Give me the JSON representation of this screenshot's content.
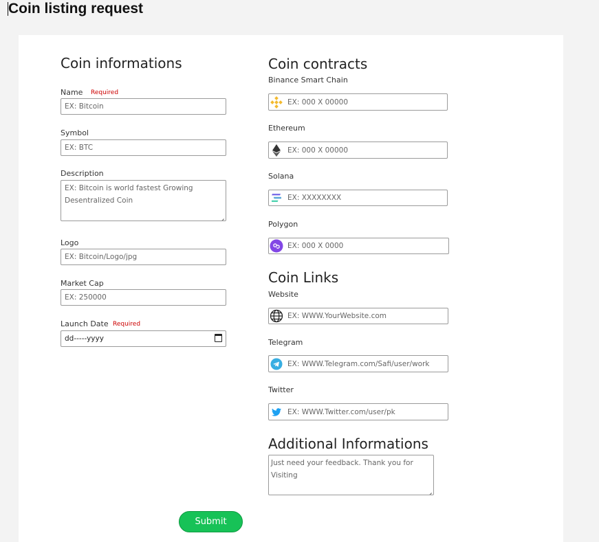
{
  "page": {
    "title": "Coin listing request"
  },
  "coin_info": {
    "heading": "Coin informations",
    "required_text": "Required",
    "name": {
      "label": "Name",
      "placeholder": "EX: Bitcoin"
    },
    "symbol": {
      "label": "Symbol",
      "placeholder": "EX: BTC"
    },
    "description": {
      "label": "Description",
      "placeholder": "EX: Bitcoin is world fastest Growing Desentralized Coin"
    },
    "logo": {
      "label": "Logo",
      "placeholder": "EX: Bitcoin/Logo/jpg"
    },
    "market_cap": {
      "label": "Market Cap",
      "placeholder": "EX: 250000"
    },
    "launch_date": {
      "label": "Launch Date",
      "value": "dd-----yyyy"
    }
  },
  "contracts": {
    "heading": "Coin contracts",
    "bsc": {
      "label": "Binance Smart Chain",
      "placeholder": "EX: 000 X 00000",
      "icon": "binance-icon",
      "color": "#F3BA2F"
    },
    "ethereum": {
      "label": "Ethereum",
      "placeholder": "EX: 000 X 00000",
      "icon": "ethereum-icon",
      "color": "#343434"
    },
    "solana": {
      "label": "Solana",
      "placeholder": "EX: XXXXXXXX",
      "icon": "solana-icon",
      "color": "#7b6ee8"
    },
    "polygon": {
      "label": "Polygon",
      "placeholder": "EX: 000 X 0000",
      "icon": "polygon-icon",
      "color": "#8247E5"
    }
  },
  "links": {
    "heading": "Coin Links",
    "website": {
      "label": "Website",
      "placeholder": "EX: WWW.YourWebsite.com",
      "icon": "globe-icon"
    },
    "telegram": {
      "label": "Telegram",
      "placeholder": "EX: WWW.Telegram.com/Safi/user/work",
      "icon": "telegram-icon",
      "color": "#37AEE2"
    },
    "twitter": {
      "label": "Twitter",
      "placeholder": "EX: WWW.Twitter.com/user/pk",
      "icon": "twitter-icon",
      "color": "#1DA1F2"
    }
  },
  "additional": {
    "heading": "Additional Informations",
    "placeholder": "Just need your feedback. Thank you for Visiting"
  },
  "submit": {
    "label": "Submit",
    "color": "#17c257"
  }
}
